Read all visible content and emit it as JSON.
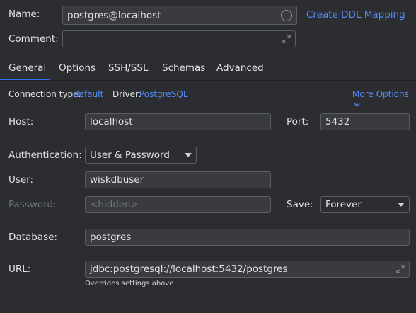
{
  "name_field": {
    "label": "Name:",
    "value": "postgres@localhost"
  },
  "ddl_link": "Create DDL Mapping",
  "comment_field": {
    "label": "Comment:",
    "value": ""
  },
  "tabs": [
    {
      "label": "General",
      "active": true
    },
    {
      "label": "Options",
      "active": false
    },
    {
      "label": "SSH/SSL",
      "active": false
    },
    {
      "label": "Schemas",
      "active": false
    },
    {
      "label": "Advanced",
      "active": false
    }
  ],
  "info_bar": {
    "connection_type_label": "Connection type:",
    "connection_type_value": "default",
    "driver_label": "Driver:",
    "driver_value": "PostgreSQL",
    "more_options": "More Options"
  },
  "host": {
    "label": "Host:",
    "value": "localhost"
  },
  "port": {
    "label": "Port:",
    "value": "5432"
  },
  "authentication": {
    "label": "Authentication:",
    "value": "User & Password"
  },
  "user": {
    "label": "User:",
    "value": "wiskdbuser"
  },
  "password": {
    "label": "Password:",
    "placeholder": "<hidden>"
  },
  "save": {
    "label": "Save:",
    "value": "Forever"
  },
  "database": {
    "label": "Database:",
    "value": "postgres"
  },
  "url": {
    "label": "URL:",
    "value": "jdbc:postgresql://localhost:5432/postgres",
    "hint": "Overrides settings above"
  },
  "colors": {
    "background": "#2b2d30",
    "accent": "#548af7",
    "tab_underline": "#3574f0",
    "input_bg": "#393b40"
  }
}
